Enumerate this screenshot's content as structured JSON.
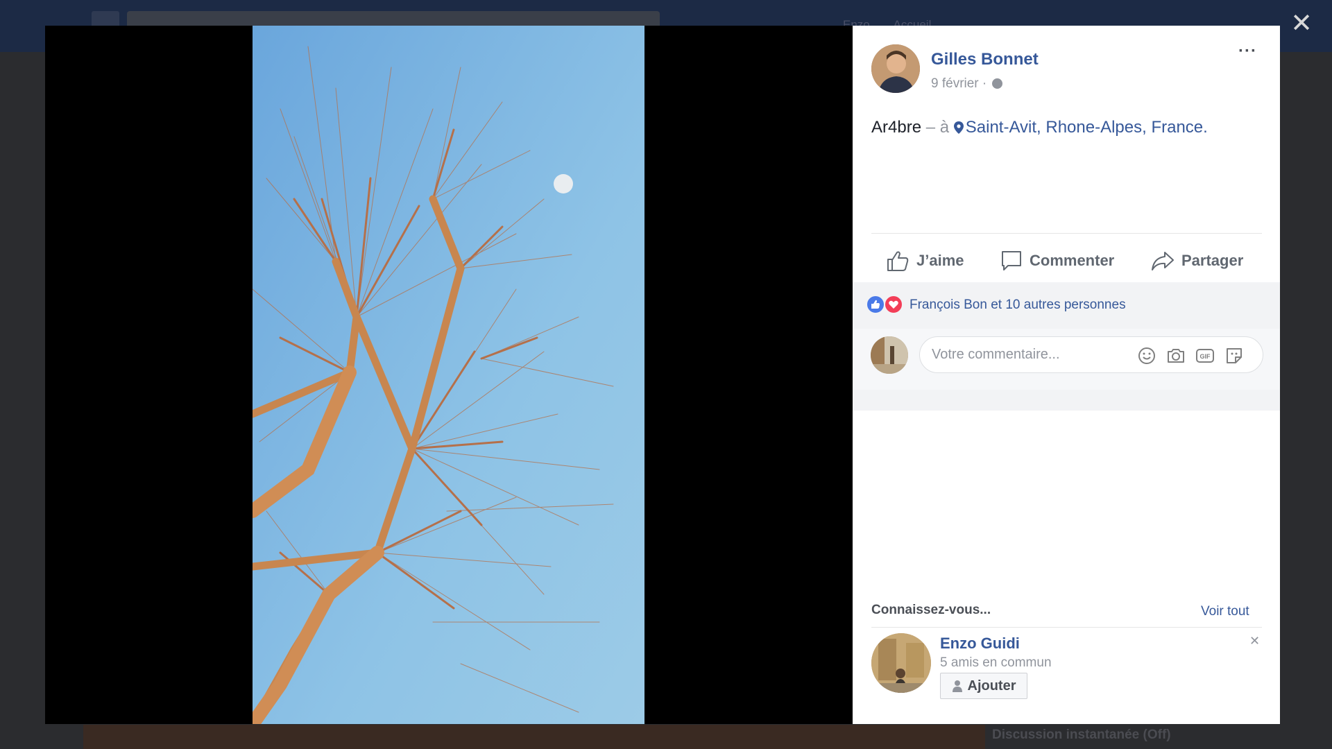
{
  "background": {
    "nav": [
      "Enzo",
      "Accueil"
    ],
    "chat_label": "Discussion instantanée (Off)"
  },
  "lightbox": {
    "close_label": "✕",
    "photo": {
      "subject": "tree-branches-with-moon"
    }
  },
  "post": {
    "author": "Gilles Bonnet",
    "date": "9 février",
    "date_separator": "·",
    "privacy_icon": "globe-icon",
    "more_label": "···",
    "text": "Ar4bre",
    "location_prefix": "– à",
    "location": "Saint-Avit, Rhone-Alpes, France",
    "location_suffix": "."
  },
  "actions": {
    "like": "J’aime",
    "comment": "Commenter",
    "share": "Partager"
  },
  "reactions": {
    "summary": "François Bon et 10 autres personnes",
    "types": [
      "like",
      "love"
    ]
  },
  "comment_box": {
    "placeholder": "Votre commentaire..."
  },
  "suggestions": {
    "title": "Connaissez-vous...",
    "see_all": "Voir tout",
    "items": [
      {
        "name": "Enzo Guidi",
        "mutual": "5 amis en commun",
        "add_label": "Ajouter"
      }
    ]
  },
  "colors": {
    "link": "#365899",
    "sky": "#8cbfe3",
    "branch": "#d98a55"
  }
}
